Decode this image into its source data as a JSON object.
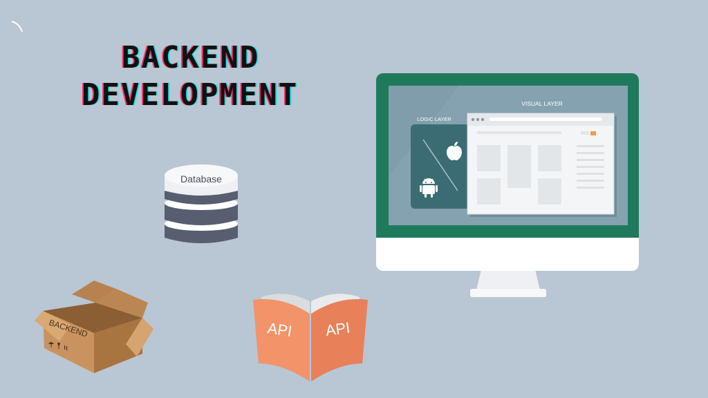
{
  "title": {
    "line1": "BACKEND",
    "line2": "DEVELOPMENT"
  },
  "database": {
    "label": "Database",
    "icon": "database-icon"
  },
  "monitor": {
    "visual_layer_label": "VISUAL LAYER",
    "logic_layer_label": "LOGIC LAYER",
    "icons": [
      "apple-icon",
      "android-icon"
    ]
  },
  "box": {
    "label": "BACKEND",
    "icon": "cardboard-box-icon"
  },
  "book": {
    "left_page_label": "API",
    "right_page_label": "API",
    "icon": "open-book-icon"
  },
  "colors": {
    "background": "#b9c6d3",
    "monitor_frame": "#1f7a5c",
    "book_cover": "#e8805a",
    "box": "#c9935f",
    "database": "#565e70"
  }
}
